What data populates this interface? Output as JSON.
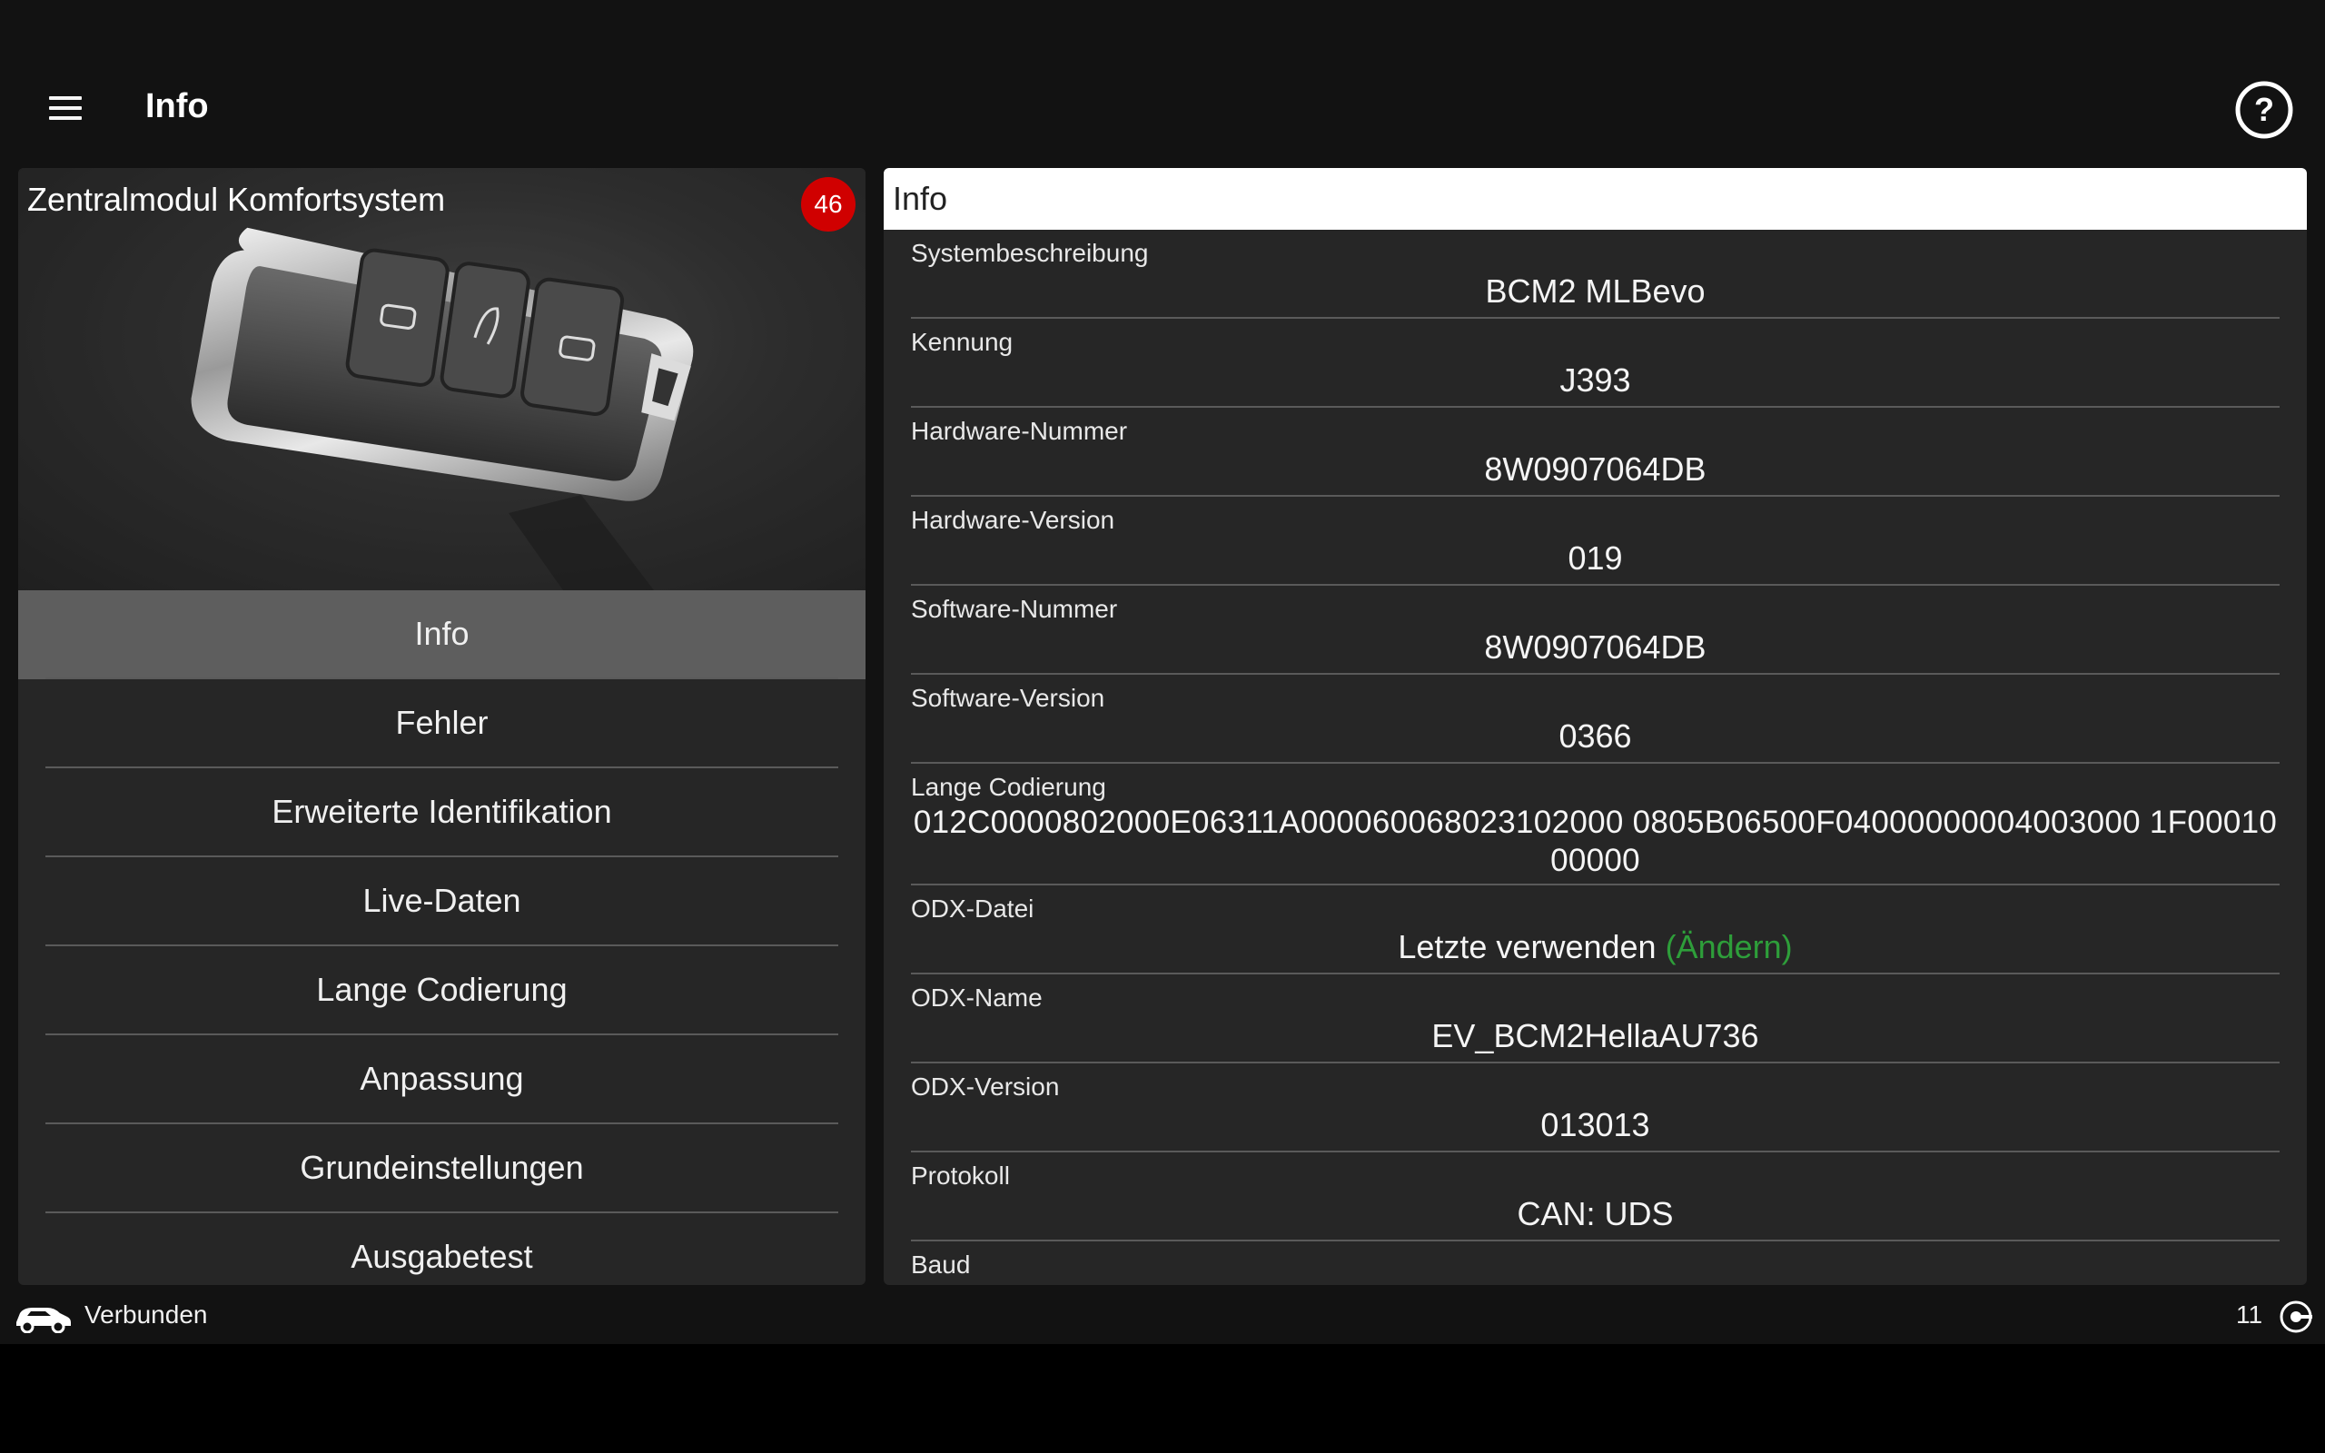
{
  "appbar": {
    "title": "Info",
    "menu_icon": "hamburger-menu-icon",
    "help_icon": "help-circle-icon"
  },
  "module": {
    "title": "Zentralmodul Komfortsystem",
    "badge": "46",
    "image": "car-key-fob-photo"
  },
  "nav": {
    "items": [
      {
        "label": "Info"
      },
      {
        "label": "Fehler"
      },
      {
        "label": "Erweiterte Identifikation"
      },
      {
        "label": "Live-Daten"
      },
      {
        "label": "Lange Codierung"
      },
      {
        "label": "Anpassung"
      },
      {
        "label": "Grundeinstellungen"
      },
      {
        "label": "Ausgabetest"
      }
    ]
  },
  "info": {
    "header": "Info",
    "rows": [
      {
        "label": "Systembeschreibung",
        "value": "BCM2 MLBevo"
      },
      {
        "label": "Kennung",
        "value": "J393"
      },
      {
        "label": "Hardware-Nummer",
        "value": "8W0907064DB"
      },
      {
        "label": "Hardware-Version",
        "value": "019"
      },
      {
        "label": "Software-Nummer",
        "value": "8W0907064DB"
      },
      {
        "label": "Software-Version",
        "value": "0366"
      },
      {
        "label": "Lange Codierung",
        "value": "012C0000802000E06311A000060068023102000 0805B06500F04000000004003000 1F0001000000"
      },
      {
        "label": "ODX-Datei",
        "value": "Letzte verwenden",
        "link": "(Ändern)"
      },
      {
        "label": "ODX-Name",
        "value": "EV_BCM2HellaAU736"
      },
      {
        "label": "ODX-Version",
        "value": "013013"
      },
      {
        "label": "Protokoll",
        "value": "CAN: UDS"
      },
      {
        "label": "Baud",
        "value": ""
      }
    ]
  },
  "status": {
    "text": "Verbunden",
    "count": "11",
    "car_icon": "car-icon",
    "connection_icon": "connection-icon"
  },
  "colors": {
    "accent_link": "#2e9e3a",
    "badge": "#d00000",
    "active_nav": "#5e5e5e"
  }
}
